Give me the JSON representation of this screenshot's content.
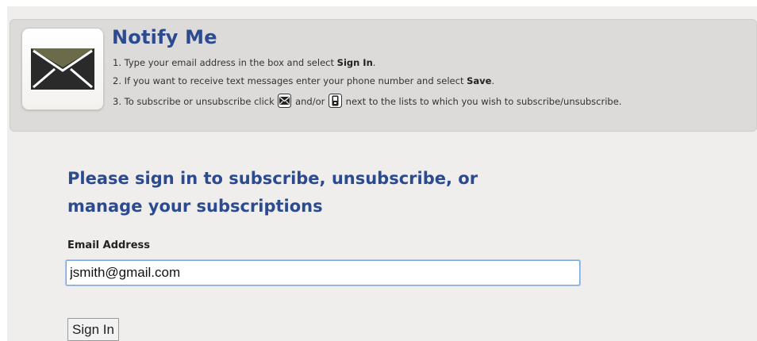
{
  "header": {
    "title": "Notify Me",
    "icon": "envelope-icon",
    "steps": [
      {
        "prefix": "1. Type your email address in the box and select ",
        "bold": "Sign In",
        "suffix": "."
      },
      {
        "prefix": "2. If you want to receive text messages enter your phone number and select ",
        "bold": "Save",
        "suffix": "."
      },
      {
        "prefix": "3. To subscribe or unsubscribe click ",
        "mid": " and/or ",
        "suffix": " next to the lists to which you wish to subscribe/unsubscribe."
      }
    ]
  },
  "signin": {
    "heading": "Please sign in to subscribe, unsubscribe, or manage your subscriptions",
    "email_label": "Email Address",
    "email_value": "jsmith@gmail.com",
    "button_label": "Sign In"
  },
  "colors": {
    "accent": "#2b4a8f",
    "banner_bg": "#dcdbd9",
    "page_bg": "#efeeec"
  }
}
